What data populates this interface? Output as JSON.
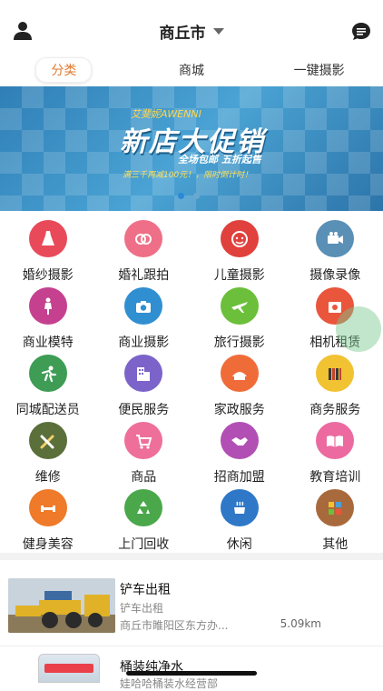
{
  "header": {
    "city": "商丘市",
    "user_icon": "user-icon",
    "chat_icon": "chat-bubble-icon"
  },
  "tabs": [
    {
      "label": "分类",
      "active": true
    },
    {
      "label": "商城",
      "active": false
    },
    {
      "label": "一键摄影",
      "active": false
    }
  ],
  "banner": {
    "brand": "艾斐妮AWENNI",
    "title": "新店大促销",
    "subtitle": "全场包邮   五折起售",
    "note": "满三千再减100元！，限时倒计时！",
    "slides": 2,
    "active_slide": 0
  },
  "categories": [
    {
      "label": "婚纱摄影",
      "icon": "wedding-dress-icon",
      "color": "#e94a5a"
    },
    {
      "label": "婚礼跟拍",
      "icon": "rings-icon",
      "color": "#ee6f87"
    },
    {
      "label": "儿童摄影",
      "icon": "baby-face-icon",
      "color": "#e0413c"
    },
    {
      "label": "摄像录像",
      "icon": "video-camera-icon",
      "color": "#5a8fb6"
    },
    {
      "label": "商业模特",
      "icon": "model-icon",
      "color": "#c5418f"
    },
    {
      "label": "商业摄影",
      "icon": "camera-icon",
      "color": "#2f8fd1"
    },
    {
      "label": "旅行摄影",
      "icon": "airplane-icon",
      "color": "#6bbf3a"
    },
    {
      "label": "相机租赁",
      "icon": "camera-rental-icon",
      "color": "#e9563c"
    },
    {
      "label": "同城配送员",
      "icon": "courier-icon",
      "color": "#3e9c55"
    },
    {
      "label": "便民服务",
      "icon": "building-icon",
      "color": "#7b63c9"
    },
    {
      "label": "家政服务",
      "icon": "housekeeping-icon",
      "color": "#ef6c39"
    },
    {
      "label": "商务服务",
      "icon": "business-icon",
      "color": "#f1c232"
    },
    {
      "label": "维修",
      "icon": "tools-icon",
      "color": "#5b6f3a"
    },
    {
      "label": "商品",
      "icon": "shopping-cart-icon",
      "color": "#ee6f9a"
    },
    {
      "label": "招商加盟",
      "icon": "handshake-icon",
      "color": "#b24fb5"
    },
    {
      "label": "教育培训",
      "icon": "book-icon",
      "color": "#ec6aa0"
    },
    {
      "label": "健身美容",
      "icon": "dumbbell-icon",
      "color": "#ee7a2a"
    },
    {
      "label": "上门回收",
      "icon": "recycle-icon",
      "color": "#4aa84a"
    },
    {
      "label": "休闲",
      "icon": "coffee-icon",
      "color": "#2f78c8"
    },
    {
      "label": "其他",
      "icon": "windmill-icon",
      "color": "#a86a3c"
    }
  ],
  "listings": [
    {
      "title": "铲车出租",
      "subtitle": "铲车出租",
      "address": "商丘市睢阳区东方办...",
      "distance": "5.09km"
    },
    {
      "title": "桶装纯净水",
      "subtitle": "娃哈哈桶装水经营部"
    }
  ]
}
